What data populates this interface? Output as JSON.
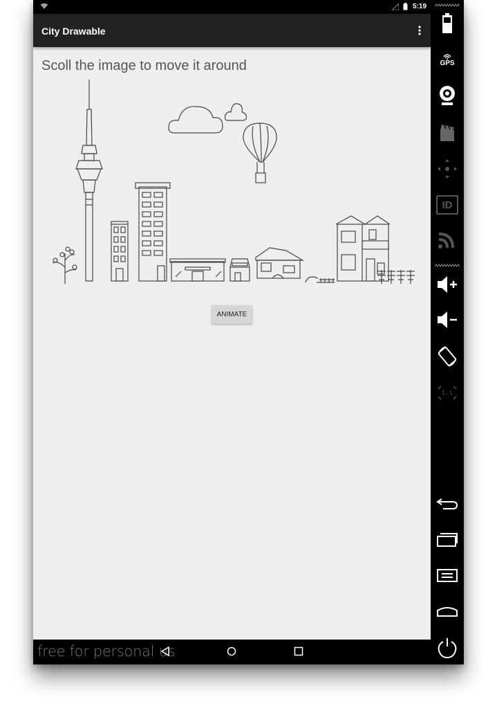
{
  "status_bar": {
    "time": "5:19"
  },
  "action_bar": {
    "title": "City Drawable"
  },
  "content": {
    "instruction_text": "Scoll the image to move it around",
    "animate_label": "ANIMATE"
  },
  "nav_bar": {
    "watermark": "free for personal us"
  },
  "side_panel": {
    "gps_label": "GPS",
    "id_label": "ID",
    "scale_label": "1 : 1"
  }
}
